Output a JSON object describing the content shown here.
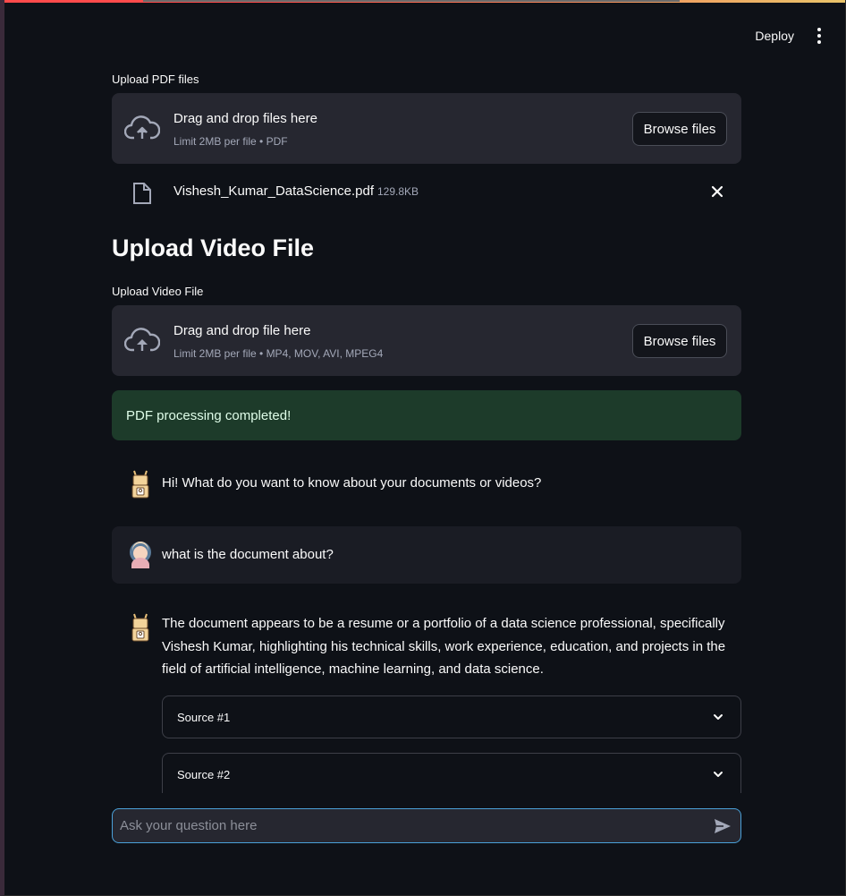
{
  "header": {
    "deploy_label": "Deploy"
  },
  "pdf_uploader": {
    "label": "Upload PDF files",
    "drop_title": "Drag and drop files here",
    "drop_sub": "Limit 2MB per file • PDF",
    "browse_label": "Browse files",
    "file": {
      "name": "Vishesh_Kumar_DataScience.pdf",
      "size": "129.8KB"
    }
  },
  "video_section": {
    "title": "Upload Video File",
    "label": "Upload Video File",
    "drop_title": "Drag and drop file here",
    "drop_sub": "Limit 2MB per file • MP4, MOV, AVI, MPEG4",
    "browse_label": "Browse files"
  },
  "status": {
    "success_text": "PDF processing completed!"
  },
  "chat": {
    "messages": [
      {
        "role": "assistant",
        "text": "Hi! What do you want to know about your documents or videos?"
      },
      {
        "role": "user",
        "text": "what is the document about?"
      },
      {
        "role": "assistant",
        "text": "The document appears to be a resume or a portfolio of a data science professional, specifically Vishesh Kumar, highlighting his technical skills, work experience, education, and projects in the field of artificial intelligence, machine learning, and data science."
      }
    ],
    "sources": [
      "Source #1",
      "Source #2"
    ],
    "input_placeholder": "Ask your question here"
  },
  "colors": {
    "background": "#0e1117",
    "dropzone": "#262730",
    "success_bg": "#1d3b2a",
    "input_border": "#4aa0d8"
  },
  "icons": [
    "cloud-upload-icon",
    "file-icon",
    "close-icon",
    "robot-avatar-icon",
    "user-avatar-icon",
    "chevron-down-icon",
    "send-icon",
    "more-vert-icon"
  ]
}
